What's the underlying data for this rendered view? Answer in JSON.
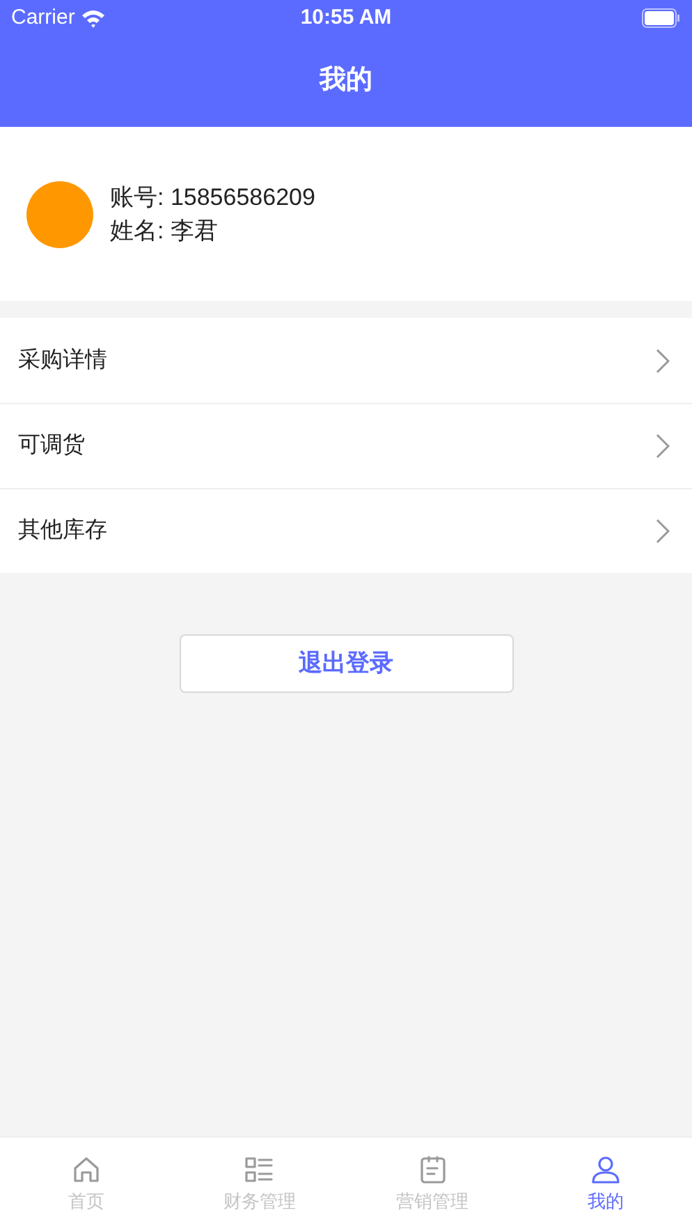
{
  "status_bar": {
    "carrier": "Carrier",
    "time": "10:55 AM"
  },
  "nav_bar": {
    "title": "我的"
  },
  "profile": {
    "account": "账号: 15856586209",
    "name": "姓名: 李君"
  },
  "menu": [
    {
      "label": "采购详情"
    },
    {
      "label": "可调货"
    },
    {
      "label": "其他库存"
    }
  ],
  "logout_button": "退出登录",
  "tab_bar": [
    {
      "label": "首页",
      "kind": "home",
      "selected": false
    },
    {
      "label": "财务管理",
      "kind": "list",
      "selected": false
    },
    {
      "label": "营销管理",
      "kind": "clipboard",
      "selected": false
    },
    {
      "label": "我的",
      "kind": "user",
      "selected": true
    }
  ]
}
